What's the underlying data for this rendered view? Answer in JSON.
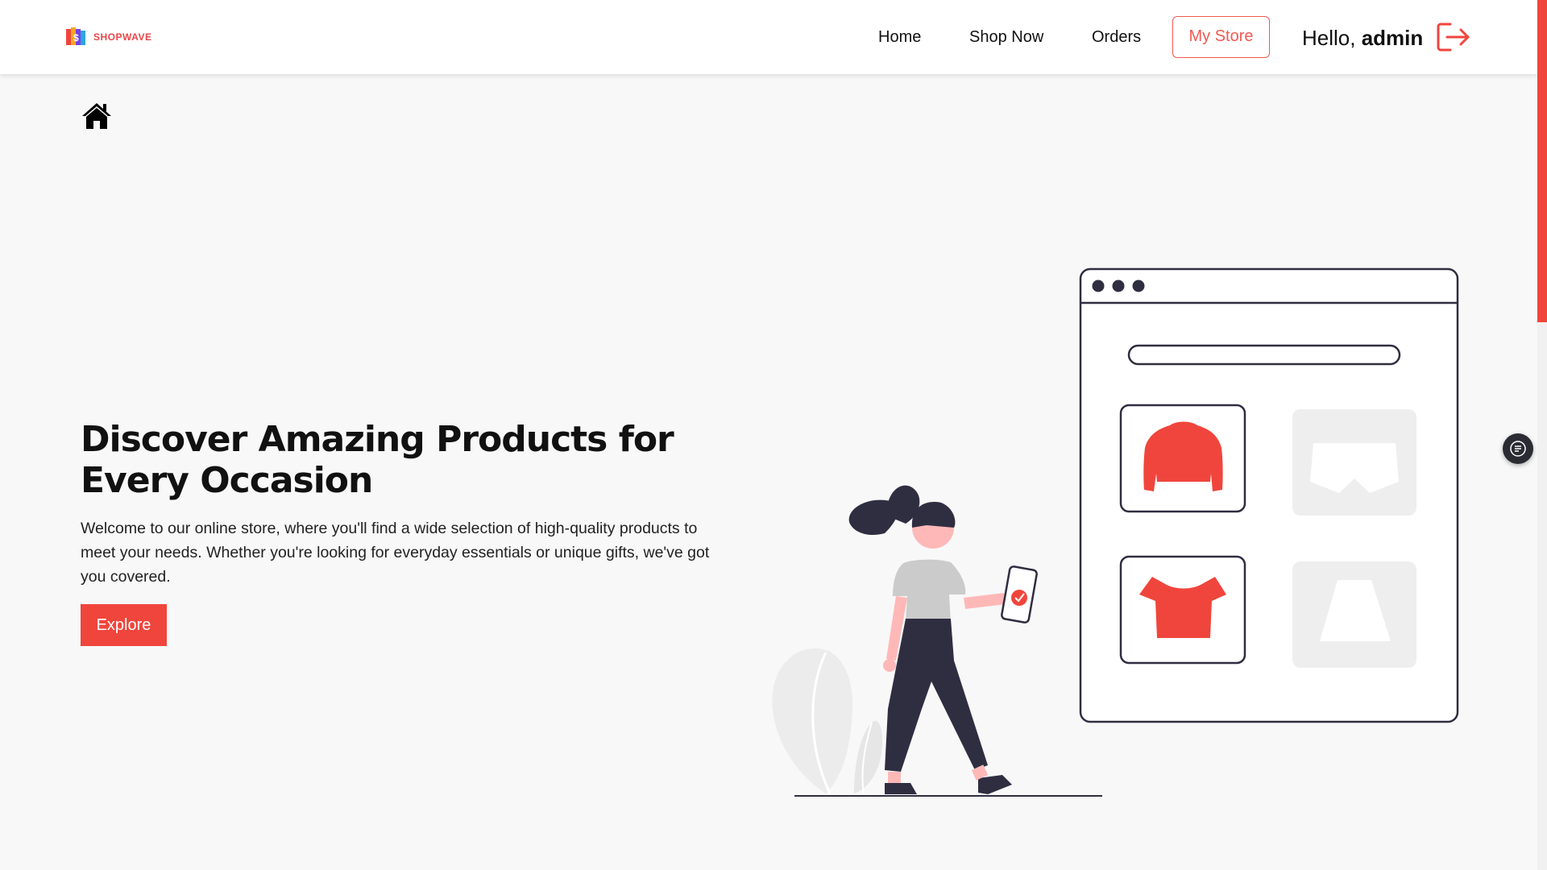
{
  "header": {
    "logo_text": "SHOPWAVE",
    "nav": {
      "home": "Home",
      "shop_now": "Shop Now",
      "orders": "Orders",
      "my_store": "My Store"
    },
    "greeting_prefix": "Hello,",
    "username": "admin"
  },
  "hero": {
    "title": "Discover Amazing Products for Every Occasion",
    "description": "Welcome to our online store, where you'll find a wide selection of high-quality products to meet your needs. Whether you're looking for everyday essentials or unique gifts, we've got you covered.",
    "cta_label": "Explore"
  },
  "colors": {
    "accent": "#f0453c",
    "header_bg": "#ffffff",
    "page_bg": "#f8f8f8",
    "dark": "#2f2e41"
  },
  "icons": {
    "home": "home-icon",
    "logout": "logout-icon",
    "widget": "list-icon"
  }
}
